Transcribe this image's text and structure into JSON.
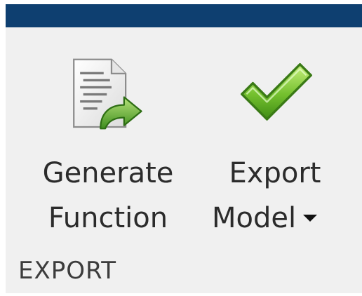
{
  "toolstrip": {
    "section_label": "EXPORT",
    "accent_color": "#0e3f70",
    "background_color": "#f0f0f0",
    "buttons": [
      {
        "label_line1": "Generate",
        "label_line2": "Function",
        "icon": "generate-function-icon"
      },
      {
        "label_line1": "Export",
        "label_line2": "Model",
        "icon": "checkmark-icon",
        "has_dropdown": true
      }
    ]
  }
}
